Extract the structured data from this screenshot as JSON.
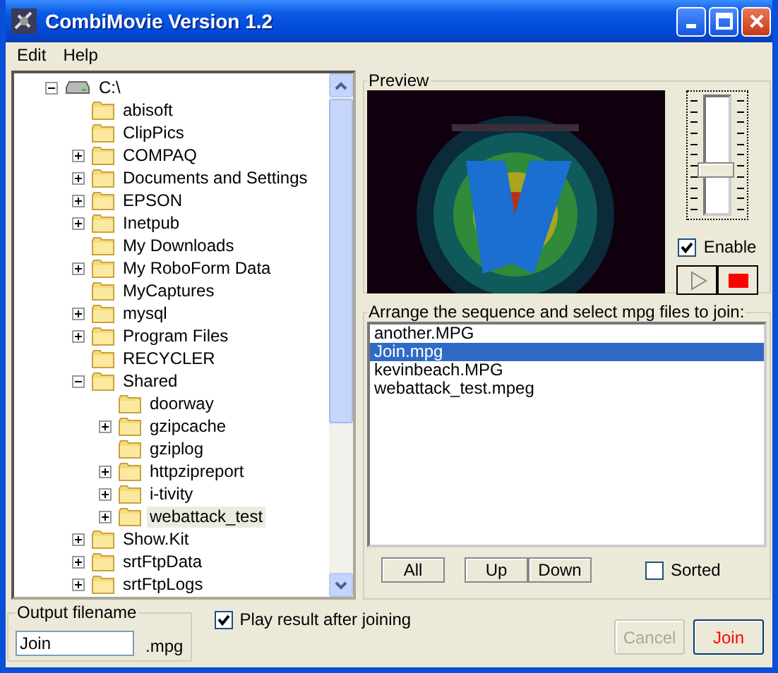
{
  "window": {
    "title": "CombiMovie Version 1.2"
  },
  "menu": [
    "Edit",
    "Help"
  ],
  "tree": [
    {
      "label": "C:\\",
      "kind": "drive",
      "expanded": true,
      "selected": false,
      "children": [
        {
          "label": "abisoft",
          "kind": "folder",
          "selected": false
        },
        {
          "label": "ClipPics",
          "kind": "folder",
          "selected": false
        },
        {
          "label": "COMPAQ",
          "kind": "folder",
          "expanded": false,
          "selected": false
        },
        {
          "label": "Documents and Settings",
          "kind": "folder",
          "expanded": false,
          "selected": false
        },
        {
          "label": "EPSON",
          "kind": "folder",
          "expanded": false,
          "selected": false
        },
        {
          "label": "Inetpub",
          "kind": "folder",
          "expanded": false,
          "selected": false
        },
        {
          "label": "My Downloads",
          "kind": "folder",
          "selected": false
        },
        {
          "label": "My RoboForm Data",
          "kind": "folder",
          "expanded": false,
          "selected": false
        },
        {
          "label": "MyCaptures",
          "kind": "folder",
          "selected": false
        },
        {
          "label": "mysql",
          "kind": "folder",
          "expanded": false,
          "selected": false
        },
        {
          "label": "Program Files",
          "kind": "folder",
          "expanded": false,
          "selected": false
        },
        {
          "label": "RECYCLER",
          "kind": "folder",
          "selected": false
        },
        {
          "label": "Shared",
          "kind": "folder",
          "expanded": true,
          "selected": false,
          "children": [
            {
              "label": "doorway",
              "kind": "folder",
              "selected": false
            },
            {
              "label": "gzipcache",
              "kind": "folder",
              "expanded": false,
              "selected": false
            },
            {
              "label": "gziplog",
              "kind": "folder",
              "selected": false
            },
            {
              "label": "httpzipreport",
              "kind": "folder",
              "expanded": false,
              "selected": false
            },
            {
              "label": "i-tivity",
              "kind": "folder",
              "expanded": false,
              "selected": false
            },
            {
              "label": "webattack_test",
              "kind": "folder",
              "expanded": false,
              "selected": true
            }
          ]
        },
        {
          "label": "Show.Kit",
          "kind": "folder",
          "expanded": false,
          "selected": false
        },
        {
          "label": "srtFtpData",
          "kind": "folder",
          "expanded": false,
          "selected": false
        },
        {
          "label": "srtFtpLogs",
          "kind": "folder",
          "expanded": false,
          "selected": false
        }
      ]
    }
  ],
  "preview": {
    "title": "Preview",
    "volume": {
      "level": 0.35
    },
    "enable": {
      "label": "Enable",
      "checked": true
    }
  },
  "files": {
    "title": "Arrange the sequence and select mpg files to join:",
    "items": [
      {
        "name": "another.MPG",
        "selected": false
      },
      {
        "name": "Join.mpg",
        "selected": true
      },
      {
        "name": "kevinbeach.MPG",
        "selected": false
      },
      {
        "name": "webattack_test.mpeg",
        "selected": false
      }
    ],
    "buttons": [
      "All",
      "Up",
      "Down"
    ],
    "sorted": {
      "label": "Sorted",
      "checked": false
    }
  },
  "output": {
    "title": "Output filename",
    "value": "Join",
    "extension": ".mpg"
  },
  "play_after": {
    "label": "Play result after joining",
    "checked": true
  },
  "actions": [
    {
      "label": "Cancel",
      "disabled": true
    },
    {
      "label": "Join",
      "disabled": false
    }
  ]
}
